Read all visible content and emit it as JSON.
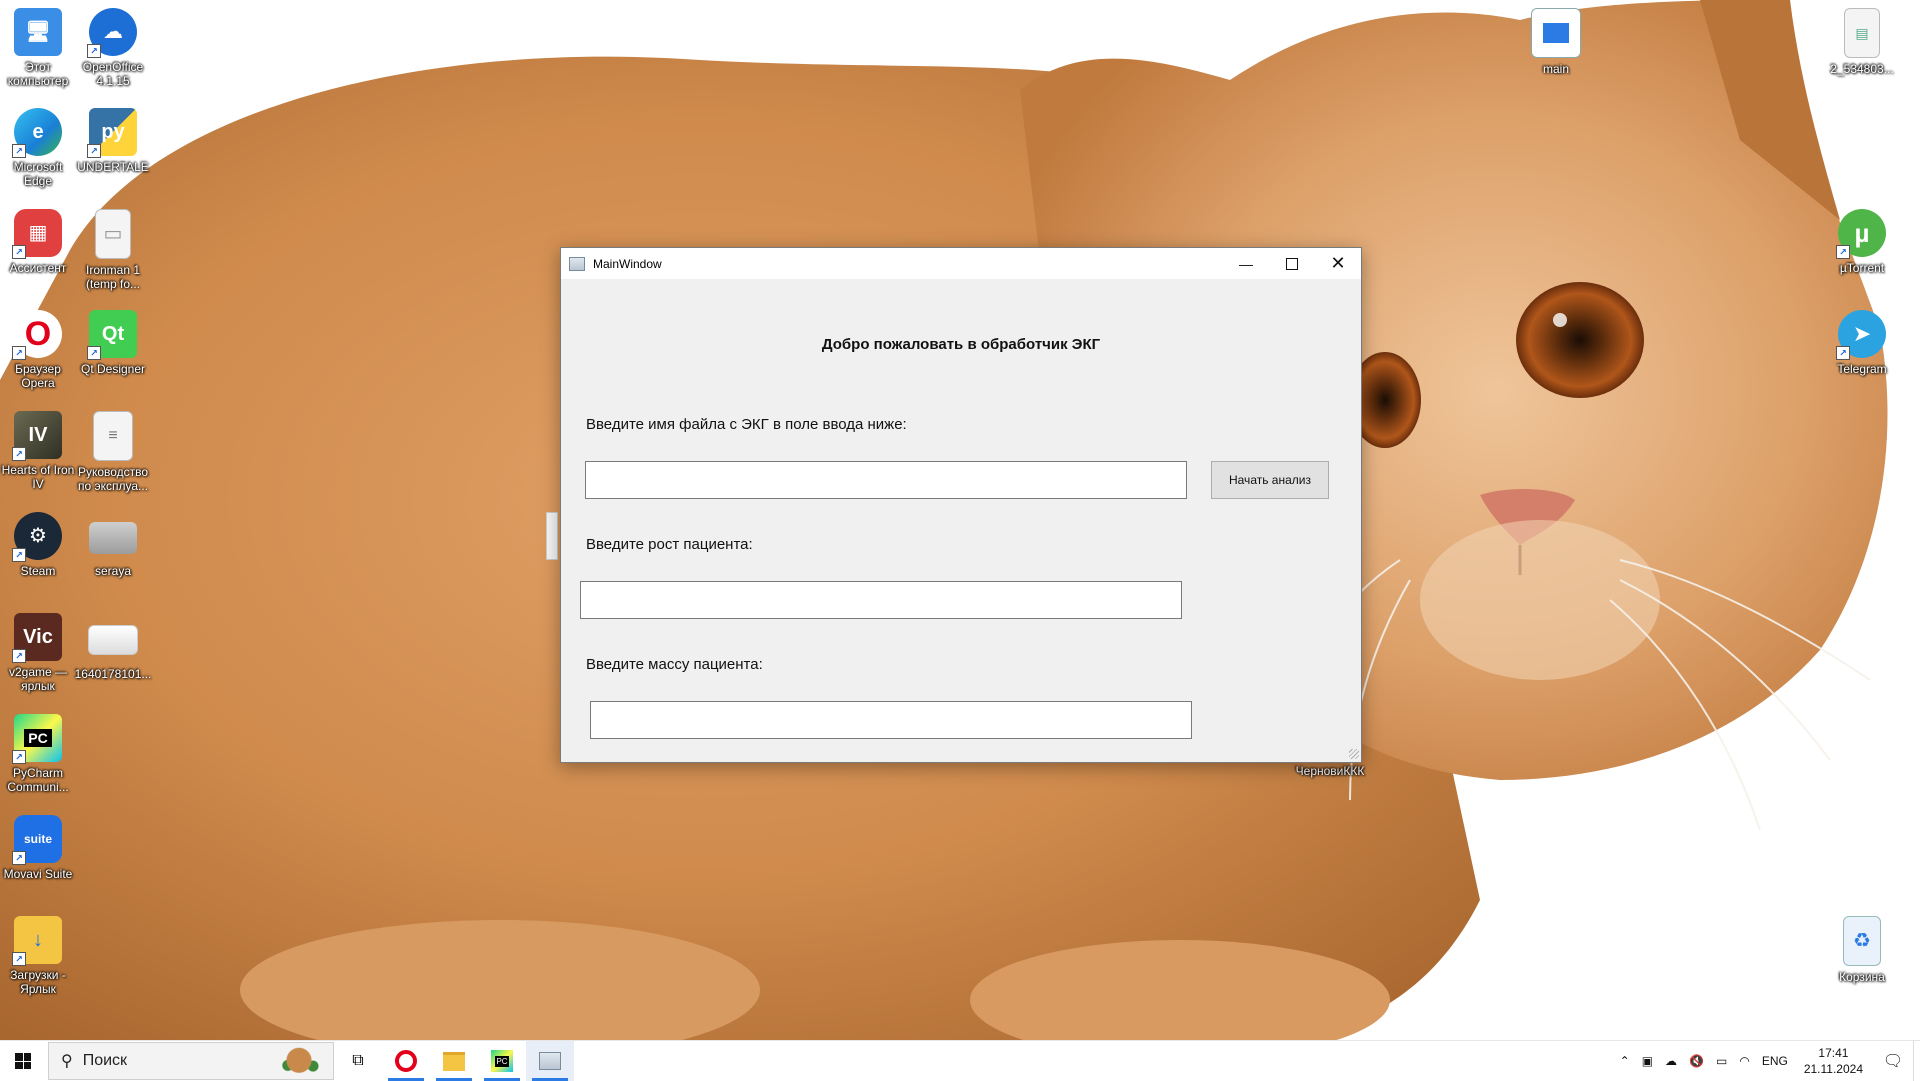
{
  "desktop": {
    "icons_left": [
      {
        "label": "Этот компьютер",
        "icon": "computer-icon",
        "color": "#3a8ee6"
      },
      {
        "label": "OpenOffice 4.1.15",
        "icon": "openoffice-icon",
        "color": "#1d6fd6"
      },
      {
        "label": "Microsoft Edge",
        "icon": "edge-icon",
        "color": "#1a9be0"
      },
      {
        "label": "UNDERTALE",
        "icon": "python-icon",
        "color": "#2b5b84"
      },
      {
        "label": "Ассистент",
        "icon": "assistant-icon",
        "color": "#e04040"
      },
      {
        "label": "Ironman 1 (temp fo...",
        "icon": "file-icon",
        "color": "#f2f2f2"
      },
      {
        "label": "Браузер Opera",
        "icon": "opera-icon",
        "color": "#e3001b"
      },
      {
        "label": "Qt Designer",
        "icon": "qt-designer-icon",
        "color": "#41cd52"
      },
      {
        "label": "Hearts of Iron IV",
        "icon": "hoi4-icon",
        "color": "#4a4a3a"
      },
      {
        "label": "Руководство по эксплуа...",
        "icon": "document-icon",
        "color": "#f2f2f2"
      },
      {
        "label": "Steam",
        "icon": "steam-icon",
        "color": "#1b2838"
      },
      {
        "label": "seraya",
        "icon": "image-gray-icon",
        "color": "#b0b0b0"
      },
      {
        "label": "v2game — ярлык",
        "icon": "victoria-icon",
        "color": "#5a2a20"
      },
      {
        "label": "1640178101...",
        "icon": "image-white-icon",
        "color": "#e8e8e8"
      },
      {
        "label": "PyCharm Communi...",
        "icon": "pycharm-icon",
        "color": "#21d789"
      },
      {
        "label": "Movavi Suite",
        "icon": "movavi-icon",
        "color": "#1f6fe5"
      },
      {
        "label": "Загрузки - Ярлык",
        "icon": "downloads-folder-icon",
        "color": "#f4c542"
      }
    ],
    "icons_right": [
      {
        "label": "main",
        "icon": "main-app-icon",
        "color": "#2c7be5"
      },
      {
        "label": "2_534803...",
        "icon": "spreadsheet-icon",
        "color": "#f2f2f2"
      },
      {
        "label": "µTorrent",
        "icon": "utorrent-icon",
        "color": "#4fb548"
      },
      {
        "label": "Telegram",
        "icon": "telegram-icon",
        "color": "#2aa3e0"
      },
      {
        "label": "Корзина",
        "icon": "recycle-bin-icon",
        "color": "#cfe3f5"
      }
    ],
    "folder_label": "ЧерновиККК"
  },
  "window": {
    "title": "MainWindow",
    "heading": "Добро пожаловать в обработчик ЭКГ",
    "file_label": "Введите имя файла с ЭКГ в поле ввода ниже:",
    "file_value": "",
    "start_button": "Начать анализ",
    "height_label": "Введите рост пациента:",
    "height_value": "",
    "mass_label": "Введите массу пациента:",
    "mass_value": ""
  },
  "taskbar": {
    "search_placeholder": "Поиск",
    "apps": [
      "task-view-icon",
      "opera-icon",
      "file-explorer-icon",
      "pycharm-icon",
      "main-app-icon"
    ],
    "language": "ENG",
    "time": "17:41",
    "date": "21.11.2024"
  }
}
